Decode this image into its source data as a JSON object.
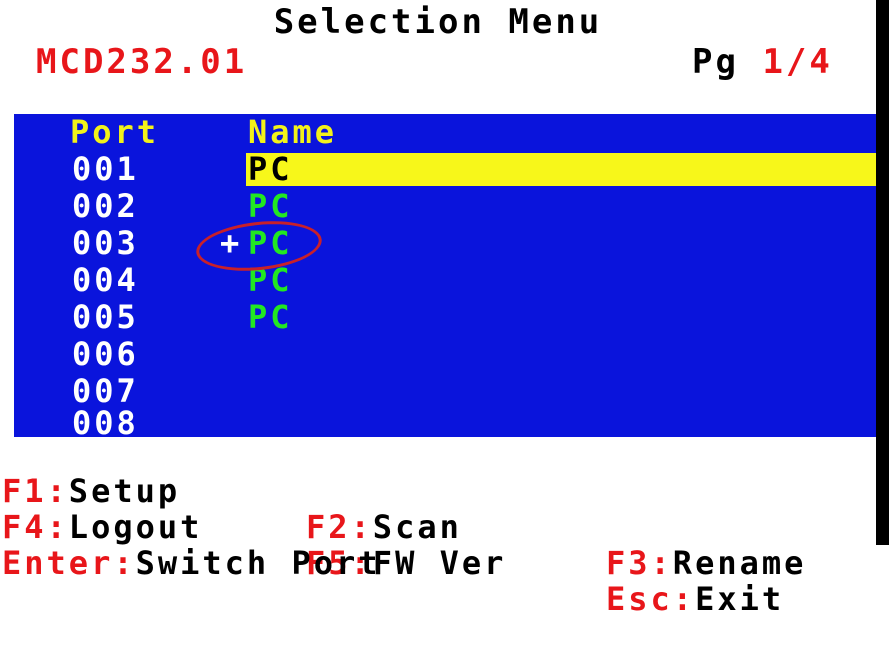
{
  "title": "Selection Menu",
  "model": "MCD232.01",
  "page": {
    "label": "Pg",
    "value": "1/4"
  },
  "columns": {
    "port": "Port",
    "name": "Name"
  },
  "rows": [
    {
      "port": "001",
      "name": "PC",
      "marker": ""
    },
    {
      "port": "002",
      "name": "PC",
      "marker": ""
    },
    {
      "port": "003",
      "name": "PC",
      "marker": "+"
    },
    {
      "port": "004",
      "name": "PC",
      "marker": ""
    },
    {
      "port": "005",
      "name": "PC",
      "marker": ""
    },
    {
      "port": "006",
      "name": "",
      "marker": ""
    },
    {
      "port": "007",
      "name": "",
      "marker": ""
    },
    {
      "port": "008",
      "name": "",
      "marker": ""
    }
  ],
  "function_keys": [
    {
      "key": "F1",
      "sep": ":",
      "label": "Setup"
    },
    {
      "key": "F2",
      "sep": ":",
      "label": "Scan"
    },
    {
      "key": "F3",
      "sep": ":",
      "label": "Rename"
    },
    {
      "key": "F4",
      "sep": ":",
      "label": "Logout"
    },
    {
      "key": "F5",
      "sep": ":",
      "label": "FW Ver"
    },
    {
      "key": "Esc",
      "sep": ":",
      "label": "Exit"
    },
    {
      "key": "Enter",
      "sep": ":",
      "label": "Switch Port"
    }
  ],
  "colors": {
    "list_bg": "#0a14dc",
    "highlight": "#f7f71a",
    "name": "#22e822",
    "key": "#e8161a",
    "annotation": "#c8202a"
  }
}
